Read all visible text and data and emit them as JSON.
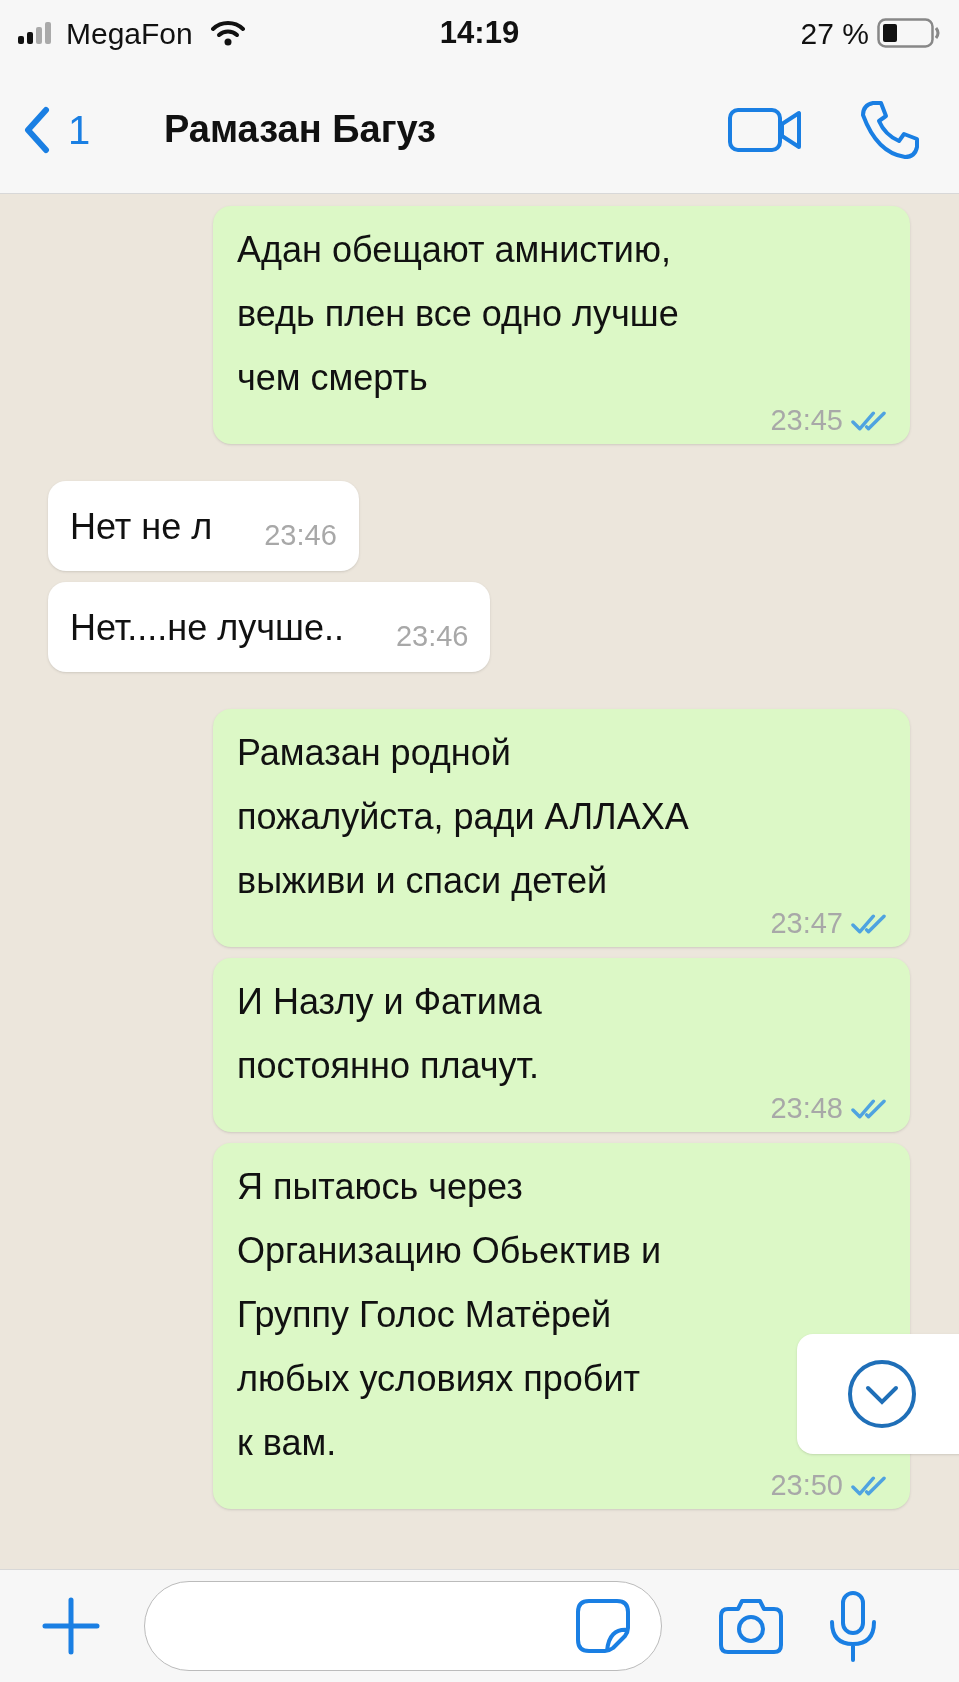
{
  "status_bar": {
    "carrier": "MegaFon",
    "time": "14:19",
    "battery": "27 %"
  },
  "header": {
    "back_count": "1",
    "contact_name": "Рамазан Багуз"
  },
  "messages": [
    {
      "kind": "outgoing",
      "text": "Адан обещают амнистию,\nведь плен все одно лучше\nчем смерть",
      "time": "23:45",
      "read": true
    },
    {
      "kind": "incoming",
      "text": "Нет не л",
      "time": "23:46"
    },
    {
      "kind": "incoming",
      "text": "Нет....не лучше..",
      "time": "23:46"
    },
    {
      "kind": "outgoing",
      "text": "Рамазан родной\nпожалуйста, ради АЛЛАХА\nвыживи и спаси детей",
      "time": "23:47",
      "read": true
    },
    {
      "kind": "outgoing",
      "text": "И Назлу и Фатима\nпостоянно плачут.",
      "time": "23:48",
      "read": true
    },
    {
      "kind": "outgoing",
      "text": "Я пытаюсь через\nОрганизацию Обьектив и\nГруппу Голос Матёрей\nлюбых условиях пробит\nк вам.",
      "time": "23:50",
      "read": true
    }
  ]
}
